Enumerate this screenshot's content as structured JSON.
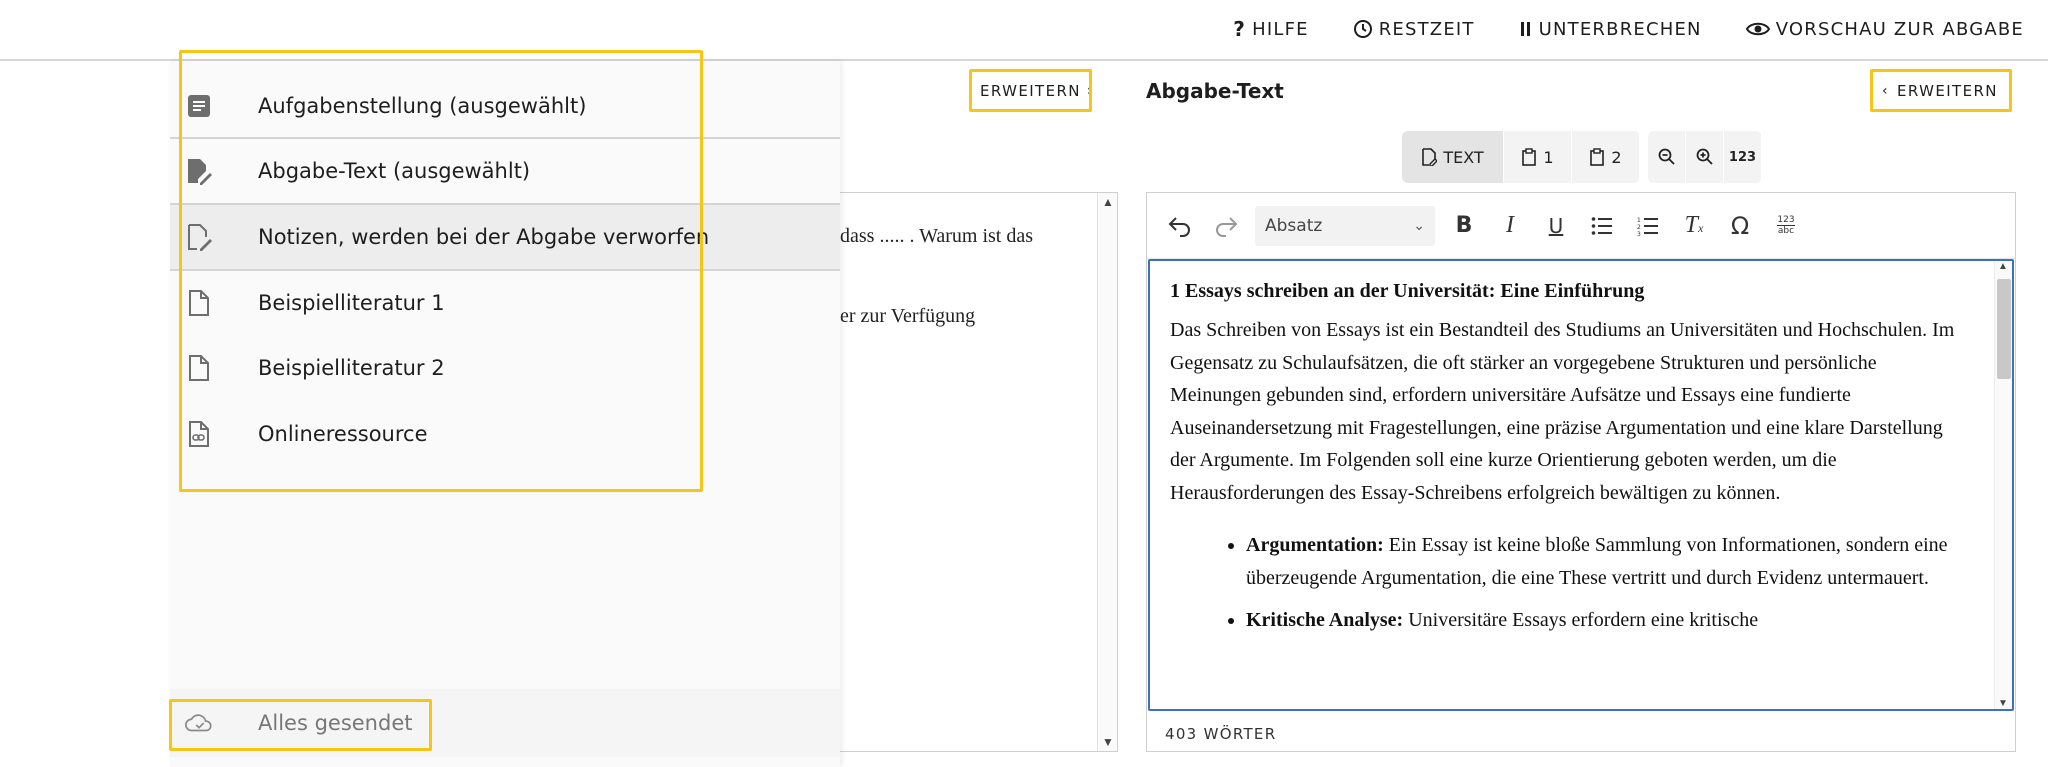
{
  "topbar": {
    "actions": [
      {
        "label": "HILFE",
        "icon": "help-icon"
      },
      {
        "label": "RESTZEIT",
        "icon": "clock-icon"
      },
      {
        "label": "UNTERBRECHEN",
        "icon": "pause-icon"
      },
      {
        "label": "VORSCHAU ZUR ABGABE",
        "icon": "eye-icon"
      }
    ]
  },
  "left_panel": {
    "expand_label": "ERWEITERN",
    "text_lines": [
      "dass ..... . Warum ist das",
      "er zur Verfügung"
    ]
  },
  "drawer": {
    "items": [
      {
        "label": "Aufgabenstellung (ausgewählt)",
        "icon": "document-filled-icon"
      },
      {
        "label": "Abgabe-Text (ausgewählt)",
        "icon": "document-edit-filled-icon"
      },
      {
        "label": "Notizen, werden bei der Abgabe verworfen",
        "icon": "document-edit-outline-icon"
      },
      {
        "label": "Beispielliteratur 1",
        "icon": "document-outline-icon"
      },
      {
        "label": "Beispielliteratur 2",
        "icon": "document-outline-icon"
      },
      {
        "label": "Onlineressource",
        "icon": "link-document-icon"
      }
    ],
    "status": {
      "label": "Alles gesendet",
      "icon": "cloud-check-icon"
    }
  },
  "right_panel": {
    "title": "Abgabe-Text",
    "expand_label": "ERWEITERN",
    "view_toggle": {
      "text_label": "TEXT",
      "page1_label": "1",
      "page2_label": "2"
    },
    "zoom": {
      "numbers_label": "123"
    },
    "toolbar": {
      "paragraph_style": "Absatz",
      "special_label": "Ω",
      "abc_top": "123",
      "abc_bottom": "abc"
    },
    "document": {
      "heading": "1 Essays schreiben an der Universität: Eine Einführung",
      "paragraph": "Das Schreiben von Essays ist ein Bestandteil des Studiums an Universitäten und Hochschulen. Im Gegensatz zu Schulaufsätzen, die oft stärker an vorgegebene Strukturen und persönliche Meinungen gebunden sind, erfordern universitäre Aufsätze und Essays eine fundierte Auseinandersetzung mit Fragestellungen, eine präzise Argumentation und eine klare Darstellung der Argumente. Im Folgenden soll eine kurze Orientierung geboten werden, um die Herausforderungen des Essay-Schreibens erfolgreich bewältigen zu können.",
      "bullets": [
        {
          "term": "Argumentation:",
          "text": " Ein Essay ist keine bloße Sammlung von Informationen, sondern eine überzeugende Argumentation, die eine These vertritt und durch Evidenz untermauert."
        },
        {
          "term": "Kritische Analyse:",
          "text": " Universitäre Essays erfordern eine kritische"
        }
      ]
    },
    "word_count": "403 WÖRTER"
  },
  "colors": {
    "highlight": "#f5c518",
    "focus_border": "#3d6fc2"
  }
}
